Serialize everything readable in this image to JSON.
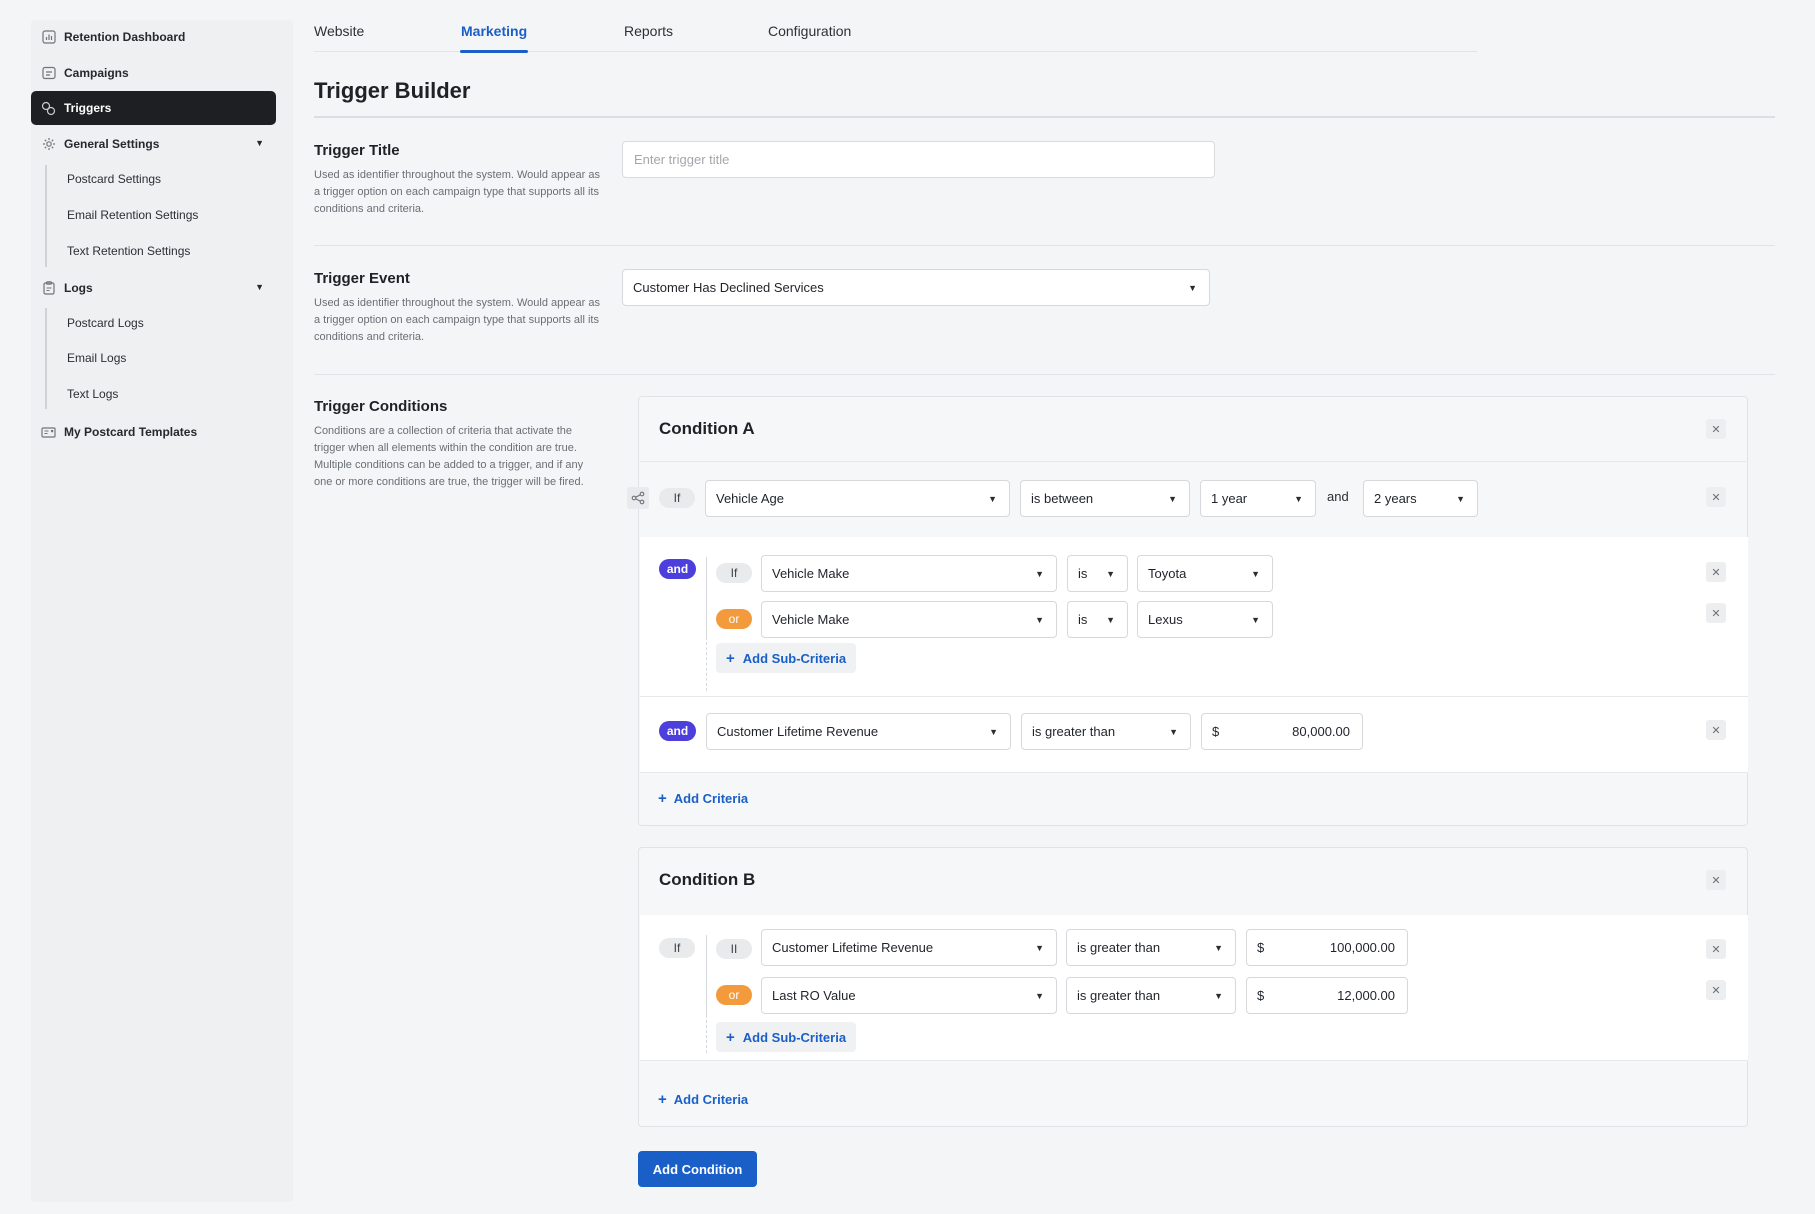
{
  "sidebar": {
    "items": [
      {
        "label": "Retention Dashboard",
        "icon": "bar-chart-icon"
      },
      {
        "label": "Campaigns",
        "icon": "calendar-icon"
      },
      {
        "label": "Triggers",
        "icon": "triggers-icon"
      },
      {
        "label": "General Settings",
        "icon": "gear-icon"
      },
      {
        "label": "Logs",
        "icon": "clipboard-icon"
      },
      {
        "label": "My Postcard Templates",
        "icon": "postcard-icon"
      }
    ],
    "general_settings_children": [
      "Postcard Settings",
      "Email Retention Settings",
      "Text Retention Settings"
    ],
    "logs_children": [
      "Postcard Logs",
      "Email Logs",
      "Text Logs"
    ]
  },
  "tabs": [
    "Website",
    "Marketing",
    "Reports",
    "Configuration"
  ],
  "active_tab": "Marketing",
  "page_title": "Trigger Builder",
  "trigger_title": {
    "heading": "Trigger Title",
    "description": "Used as identifier throughout the system. Would appear as a trigger option on each campaign type that supports all its conditions and criteria.",
    "placeholder": "Enter trigger title"
  },
  "trigger_event": {
    "heading": "Trigger Event",
    "description": "Used as identifier throughout the system. Would appear as a trigger option on each campaign type that supports all its conditions and criteria.",
    "value": "Customer Has Declined Services"
  },
  "trigger_conditions": {
    "heading": "Trigger Conditions",
    "description": "Conditions are a collection of criteria that activate the trigger when all elements within the condition are true. Multiple conditions can be added to a trigger, and if any one or more conditions are true, the trigger will be fired."
  },
  "condition_a": {
    "title": "Condition A",
    "row1": {
      "connector": "If",
      "field": "Vehicle Age",
      "operator": "is between",
      "from": "1 year",
      "and": "and",
      "to": "2 years"
    },
    "group": {
      "connector": "and",
      "sub1": {
        "connector": "If",
        "field": "Vehicle Make",
        "operator": "is",
        "value": "Toyota"
      },
      "sub2": {
        "connector": "or",
        "field": "Vehicle Make",
        "operator": "is",
        "value": "Lexus"
      },
      "add_sub": "Add Sub-Criteria"
    },
    "row3": {
      "connector": "and",
      "field": "Customer Lifetime Revenue",
      "operator": "is greater than",
      "currency": "$",
      "amount": "80,000.00"
    },
    "add_criteria": "Add Criteria"
  },
  "condition_b": {
    "title": "Condition B",
    "group": {
      "connector": "If",
      "sub1": {
        "connector": "II",
        "field": "Customer Lifetime Revenue",
        "operator": "is greater than",
        "currency": "$",
        "amount": "100,000.00"
      },
      "sub2": {
        "connector": "or",
        "field": "Last RO Value",
        "operator": "is greater than",
        "currency": "$",
        "amount": "12,000.00"
      },
      "add_sub": "Add Sub-Criteria"
    },
    "add_criteria": "Add Criteria"
  },
  "add_condition": "Add Condition",
  "colors": {
    "accent": "#1a5fc7",
    "and_pill": "#4d3fdc",
    "or_pill": "#f39a3d",
    "active_nav": "#1d1f22"
  }
}
